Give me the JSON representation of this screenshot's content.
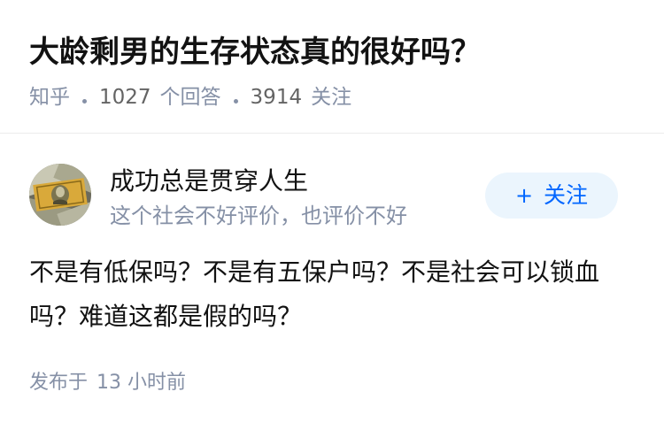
{
  "question": {
    "title": "大龄剩男的生存状态真的很好吗？",
    "source": "知乎",
    "answer_count": "1027",
    "answer_label": "个回答",
    "follower_count": "3914",
    "follower_label": "关注"
  },
  "answer": {
    "author_name": "成功总是贯穿人生",
    "author_bio": "这个社会不好评价，也评价不好",
    "follow_button_label": "关注",
    "content": "不是有低保吗？不是有五保户吗？不是社会可以锁血吗？难道这都是假的吗？",
    "published_prefix": "发布于",
    "published_time": "13 小时前"
  },
  "colors": {
    "title": "#121212",
    "meta": "#8590a6",
    "accent": "#0066ff",
    "follow_bg": "#ebf5fd",
    "divider": "#ececec"
  },
  "icons": {
    "avatar": "dollar-bills-avatar",
    "follow": "plus-icon"
  }
}
